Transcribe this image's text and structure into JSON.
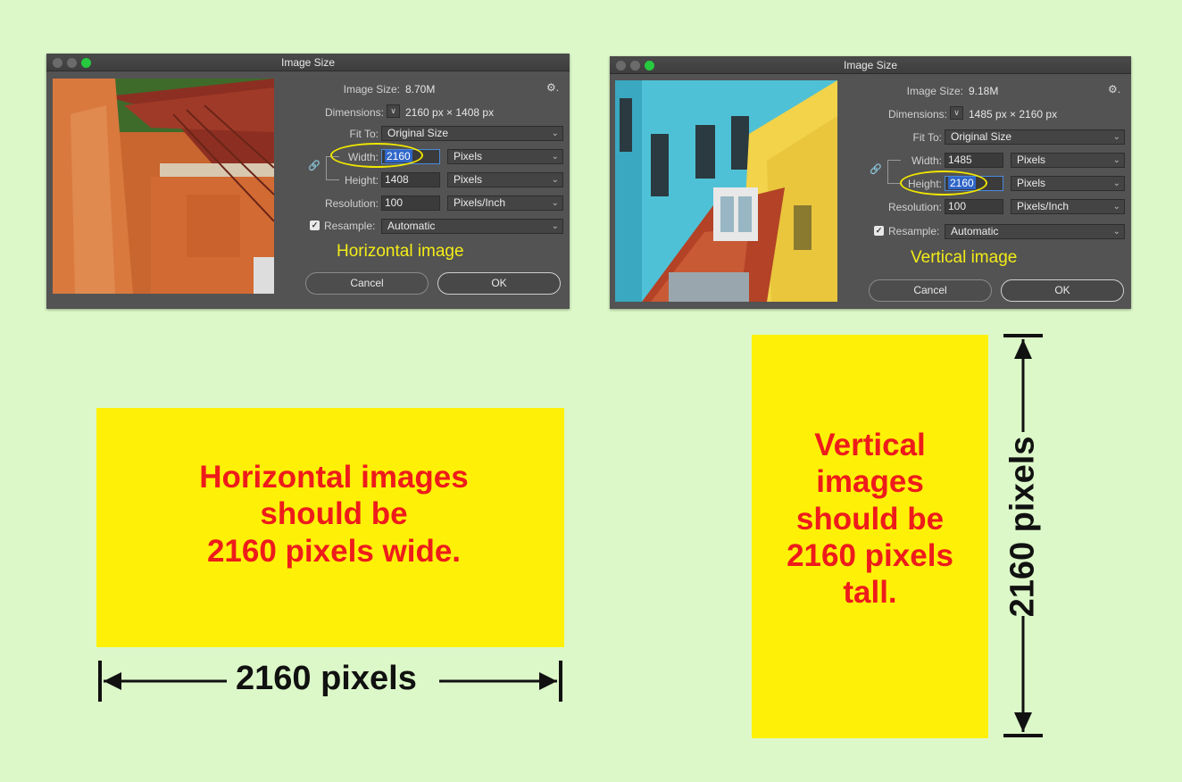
{
  "dialog_left": {
    "title": "Image Size",
    "image_size_label": "Image Size:",
    "image_size_value": "8.70M",
    "dimensions_label": "Dimensions:",
    "dimensions_value": "2160 px  ×  1408 px",
    "fit_to_label": "Fit To:",
    "fit_to_value": "Original Size",
    "width_label": "Width:",
    "width_value": "2160",
    "width_unit": "Pixels",
    "height_label": "Height:",
    "height_value": "1408",
    "height_unit": "Pixels",
    "resolution_label": "Resolution:",
    "resolution_value": "100",
    "resolution_unit": "Pixels/Inch",
    "resample_label": "Resample:",
    "resample_value": "Automatic",
    "caption": "Horizontal image",
    "cancel_label": "Cancel",
    "ok_label": "OK"
  },
  "dialog_right": {
    "title": "Image Size",
    "image_size_label": "Image Size:",
    "image_size_value": "9.18M",
    "dimensions_label": "Dimensions:",
    "dimensions_value": "1485 px  ×  2160 px",
    "fit_to_label": "Fit To:",
    "fit_to_value": "Original Size",
    "width_label": "Width:",
    "width_value": "1485",
    "width_unit": "Pixels",
    "height_label": "Height:",
    "height_value": "2160",
    "height_unit": "Pixels",
    "resolution_label": "Resolution:",
    "resolution_value": "100",
    "resolution_unit": "Pixels/Inch",
    "resample_label": "Resample:",
    "resample_value": "Automatic",
    "caption": "Vertical image",
    "cancel_label": "Cancel",
    "ok_label": "OK"
  },
  "horizontal_box": {
    "line1": "Horizontal images",
    "line2": "should be",
    "line3": "2160 pixels wide.",
    "dimension_label": "2160 pixels"
  },
  "vertical_box": {
    "line1": "Vertical",
    "line2": "images",
    "line3": "should be",
    "line4": "2160 pixels",
    "line5": "tall.",
    "dimension_label": "2160 pixels"
  },
  "colors": {
    "background": "#dcf8c8",
    "box_yellow": "#fef107",
    "box_text_red": "#ee1b1b",
    "caption_yellow": "#f3ec18",
    "dialog_gray": "#535353"
  }
}
